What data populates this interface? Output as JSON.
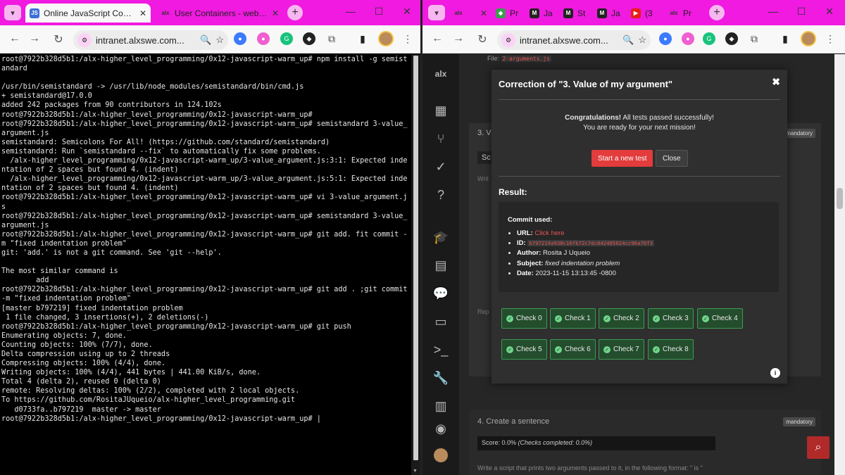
{
  "left_window": {
    "tabs": [
      {
        "label": "Online JavaScript Compiler",
        "favicon": "JS",
        "active": true
      },
      {
        "label": "User Containers - webterm",
        "favicon": "alx",
        "active": false
      }
    ],
    "address": "intranet.alxswe.com...",
    "terminal_lines": [
      "root@7922b328d5b1:/alx-higher_level_programming/0x12-javascript-warm_up# npm install -g semistandard",
      "",
      "/usr/bin/semistandard -> /usr/lib/node_modules/semistandard/bin/cmd.js",
      "+ semistandard@17.0.0",
      "added 242 packages from 90 contributors in 124.102s",
      "root@7922b328d5b1:/alx-higher_level_programming/0x12-javascript-warm_up#",
      "root@7922b328d5b1:/alx-higher_level_programming/0x12-javascript-warm_up# semistandard 3-value_argument.js",
      "semistandard: Semicolons For All! (https://github.com/standard/semistandard)",
      "semistandard: Run `semistandard --fix` to automatically fix some problems.",
      "  /alx-higher_level_programming/0x12-javascript-warm_up/3-value_argument.js:3:1: Expected indentation of 2 spaces but found 4. (indent)",
      "  /alx-higher_level_programming/0x12-javascript-warm_up/3-value_argument.js:5:1: Expected indentation of 2 spaces but found 4. (indent)",
      "root@7922b328d5b1:/alx-higher_level_programming/0x12-javascript-warm_up# vi 3-value_argument.js",
      "root@7922b328d5b1:/alx-higher_level_programming/0x12-javascript-warm_up# semistandard 3-value_argument.js",
      "root@7922b328d5b1:/alx-higher_level_programming/0x12-javascript-warm_up# git add. fit commit -m \"fixed indentation problem\"",
      "git: 'add.' is not a git command. See 'git --help'.",
      "",
      "The most similar command is",
      "        add",
      "root@7922b328d5b1:/alx-higher_level_programming/0x12-javascript-warm_up# git add . ;git commit -m \"fixed indentation problem\"",
      "[master b797219] fixed indentation problem",
      " 1 file changed, 3 insertions(+), 2 deletions(-)",
      "root@7922b328d5b1:/alx-higher_level_programming/0x12-javascript-warm_up# git push",
      "Enumerating objects: 7, done.",
      "Counting objects: 100% (7/7), done.",
      "Delta compression using up to 2 threads",
      "Compressing objects: 100% (4/4), done.",
      "Writing objects: 100% (4/4), 441 bytes | 441.00 KiB/s, done.",
      "Total 4 (delta 2), reused 0 (delta 0)",
      "remote: Resolving deltas: 100% (2/2), completed with 2 local objects.",
      "To https://github.com/RositaJUqueio/alx-higher_level_programming.git",
      "   d0733fa..b797219  master -> master",
      "root@7922b328d5b1:/alx-higher_level_programming/0x12-javascript-warm_up# |"
    ]
  },
  "right_window": {
    "tabs": [
      {
        "label": "Pr",
        "favicon": "alx"
      },
      {
        "label": "Ja",
        "favicon": "M"
      },
      {
        "label": "St",
        "favicon": "M"
      },
      {
        "label": "Ja",
        "favicon": "M"
      },
      {
        "label": "(3",
        "favicon": "yt"
      },
      {
        "label": "Pr",
        "favicon": "alx"
      }
    ],
    "address": "intranet.alxswe.com...",
    "sidebar_logo": "alx",
    "page": {
      "file_label": "File:",
      "file_name": "2-arguments.js",
      "task3_title": "3. V",
      "task3_badge": "mandatory",
      "task3_tab": "Sc",
      "task3_write": "Writ",
      "task3_rep": "Rep",
      "task4_title": "4. Create a sentence",
      "task4_badge": "mandatory",
      "task4_score": "Score: 0.0%",
      "task4_checks": "(Checks completed: 0.0%)",
      "task4_desc": "Write a script that prints two arguments passed to it, in the following format: \" is \""
    },
    "modal": {
      "title": "Correction of \"3. Value of my argument\"",
      "congrats_bold": "Congratulations!",
      "congrats_rest": " All tests passed successfully!",
      "congrats_line2": "You are ready for your next mission!",
      "start_button": "Start a new test",
      "close_button": "Close",
      "result_title": "Result:",
      "commit_used": "Commit used:",
      "url_label": "URL:",
      "url_value": "Click here",
      "id_label": "ID:",
      "id_value": "b797219a930c16fb72c7dc042405024cc96a76f3",
      "author_label": "Author:",
      "author_value": "Rosita J Uqueio",
      "subject_label": "Subject:",
      "subject_value": "fixed indentation problem",
      "date_label": "Date:",
      "date_value": "2023-11-15 13:13:45 -0800",
      "checks": [
        "Check 0",
        "Check 1",
        "Check 2",
        "Check 3",
        "Check 4",
        "Check 5",
        "Check 6",
        "Check 7",
        "Check 8"
      ]
    }
  }
}
